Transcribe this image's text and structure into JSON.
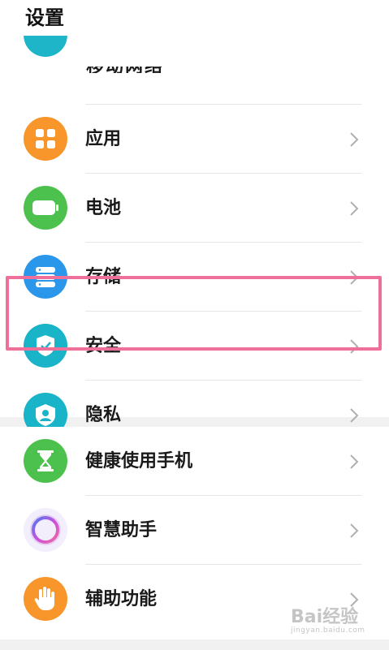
{
  "header": {
    "title": "设置"
  },
  "group1": {
    "partial_item": {
      "label": "移动网络",
      "icon": "cellular-icon",
      "color": "#1fb5c9"
    },
    "items": [
      {
        "label": "应用",
        "icon": "apps-grid-icon",
        "color": "#f8962c"
      },
      {
        "label": "电池",
        "icon": "battery-icon",
        "color": "#4cc14d"
      },
      {
        "label": "存储",
        "icon": "storage-icon",
        "color": "#2a97ea"
      },
      {
        "label": "安全",
        "icon": "shield-check-icon",
        "color": "#19b4c8"
      },
      {
        "label": "隐私",
        "icon": "privacy-icon",
        "color": "#19b4c8"
      }
    ]
  },
  "group2": {
    "items": [
      {
        "label": "健康使用手机",
        "icon": "hourglass-icon",
        "color": "#4cc14d"
      },
      {
        "label": "智慧助手",
        "icon": "assistant-ring-icon",
        "color": "#f3eefb"
      },
      {
        "label": "辅助功能",
        "icon": "hand-icon",
        "color": "#f8962c"
      }
    ]
  },
  "highlight": {
    "color": "#ed6f9a",
    "target": "安全"
  },
  "watermark": {
    "text": "Bai经验",
    "sub": "jingyan.baidu.com"
  }
}
